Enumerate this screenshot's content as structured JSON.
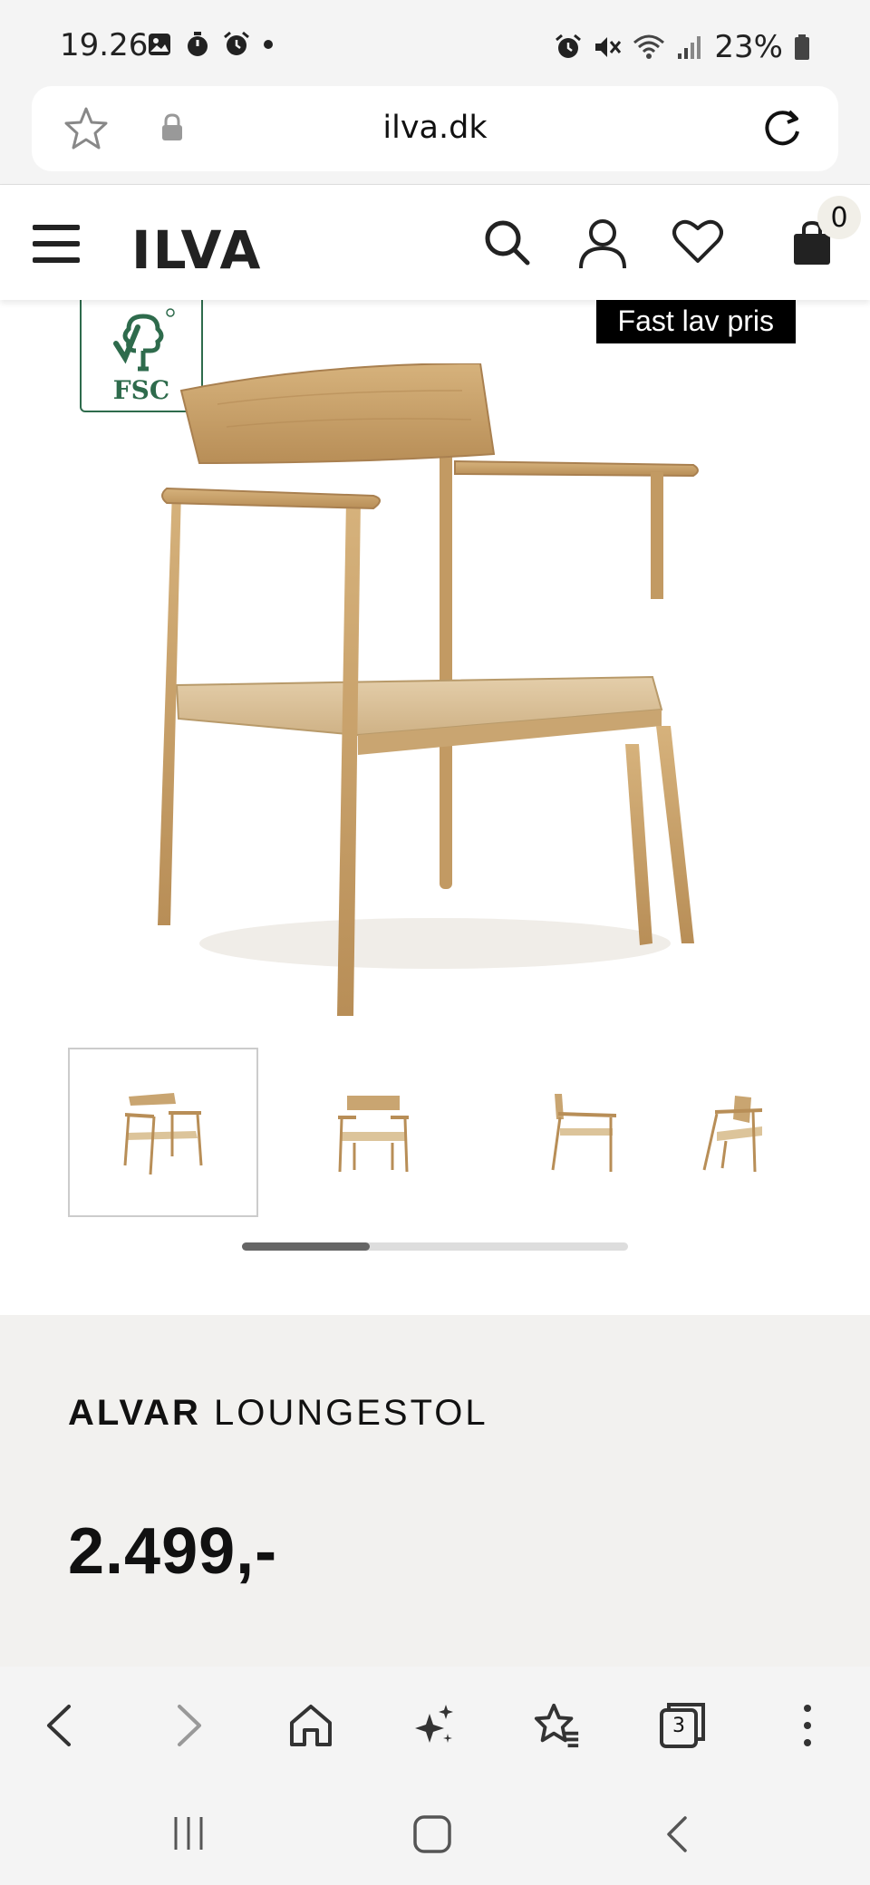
{
  "status_bar": {
    "time": "19.26",
    "battery": "23%",
    "left_icons": [
      "image-icon",
      "timer-icon",
      "alarm-icon",
      "dot-icon"
    ],
    "right_icons": [
      "alarm-icon",
      "mute-icon",
      "wifi-icon",
      "signal-icon",
      "battery-icon"
    ]
  },
  "browser": {
    "url": "ilva.dk"
  },
  "site_header": {
    "logo": "ILVA",
    "cart_count": "0"
  },
  "product": {
    "badge_label": "Fast lav pris",
    "fsc_label": "FSC",
    "brand": "ALVAR",
    "name": "LOUNGESTOL",
    "price": "2.499,-",
    "thumbnail_count": 4,
    "gallery_scroll_position": 0.33
  },
  "browser_toolbar": {
    "tab_count": "3"
  },
  "colors": {
    "wood": "#c9a571",
    "seat": "#dcc49a",
    "fsc_green": "#2e6b4c",
    "info_bg": "#f2f1ef"
  }
}
